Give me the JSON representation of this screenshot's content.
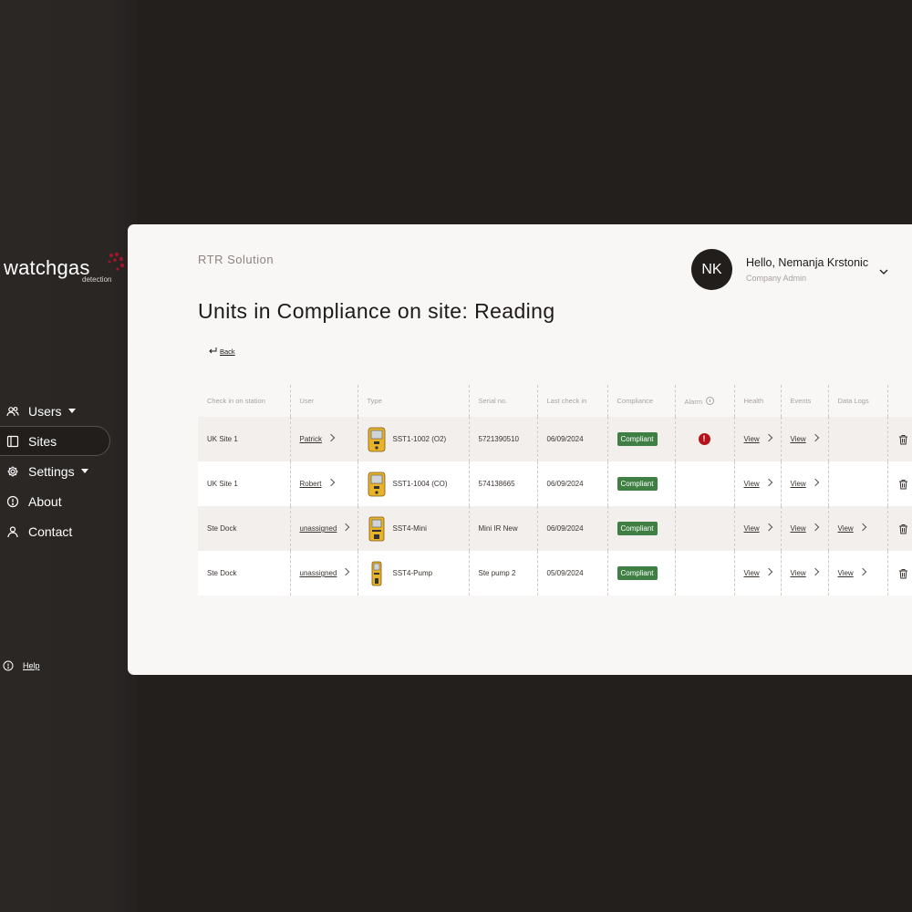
{
  "logo": {
    "word": "watchgas",
    "sub": "detection"
  },
  "colors": {
    "sidebar_bg": "#2b2725",
    "panel_bg": "#f9f7f6",
    "badge_green": "#3f7f43",
    "alarm_red": "#b5121b"
  },
  "nav": {
    "items": [
      {
        "label": "Users",
        "icon": "users-icon",
        "has_caret": true
      },
      {
        "label": "Sites",
        "icon": "sites-icon",
        "active": true
      },
      {
        "label": "Settings",
        "icon": "gear-icon",
        "has_caret": true
      },
      {
        "label": "About",
        "icon": "info-icon"
      },
      {
        "label": "Contact",
        "icon": "person-icon"
      }
    ],
    "help": "Help"
  },
  "header": {
    "brand": "RTR Solution",
    "title": "Units in Compliance on site: Reading",
    "back": "Back",
    "user": {
      "initials": "NK",
      "greeting": "Hello, Nemanja Krstonic",
      "role": "Company Admin"
    }
  },
  "table": {
    "columns": [
      "Check in on station",
      "User",
      "Type",
      "Serial no.",
      "Last check in",
      "Compliance",
      "Alarm",
      "Health",
      "Events",
      "Data Logs",
      ""
    ],
    "rows": [
      {
        "station": "UK Site 1",
        "user": "Patrick",
        "type": "SST1-1002 (O2)",
        "device": "sst1",
        "serial": "5721390510",
        "last": "06/09/2024",
        "compliance": "Compliant",
        "alarm": "!",
        "health": "View",
        "events": "View",
        "logs": ""
      },
      {
        "station": "UK Site 1",
        "user": "Robert",
        "type": "SST1-1004 (CO)",
        "device": "sst1",
        "serial": "574138665",
        "last": "06/09/2024",
        "compliance": "Compliant",
        "alarm": "",
        "health": "View",
        "events": "View",
        "logs": ""
      },
      {
        "station": "Ste Dock",
        "user": "unassigned",
        "type": "SST4-Mini",
        "device": "sst4mini",
        "serial": "Mini IR New",
        "last": "06/09/2024",
        "compliance": "Compliant",
        "alarm": "",
        "health": "View",
        "events": "View",
        "logs": "View"
      },
      {
        "station": "Ste Dock",
        "user": "unassigned",
        "type": "SST4-Pump",
        "device": "sst4pump",
        "serial": "Ste pump 2",
        "last": "05/09/2024",
        "compliance": "Compliant",
        "alarm": "",
        "health": "View",
        "events": "View",
        "logs": "View"
      }
    ]
  }
}
